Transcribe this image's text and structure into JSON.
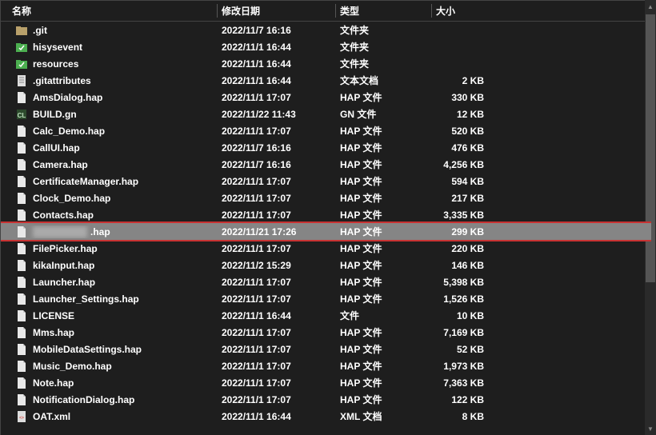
{
  "columns": {
    "name": "名称",
    "date": "修改日期",
    "type": "类型",
    "size": "大小"
  },
  "rows": [
    {
      "icon": "folder-plain",
      "name": ".git",
      "date": "2022/11/7 16:16",
      "type": "文件夹",
      "size": ""
    },
    {
      "icon": "folder-green",
      "name": "hisysevent",
      "date": "2022/11/1 16:44",
      "type": "文件夹",
      "size": ""
    },
    {
      "icon": "folder-green",
      "name": "resources",
      "date": "2022/11/1 16:44",
      "type": "文件夹",
      "size": ""
    },
    {
      "icon": "file-txt",
      "name": ".gitattributes",
      "date": "2022/11/1 16:44",
      "type": "文本文档",
      "size": "2 KB"
    },
    {
      "icon": "file-generic",
      "name": "AmsDialog.hap",
      "date": "2022/11/1 17:07",
      "type": "HAP 文件",
      "size": "330 KB"
    },
    {
      "icon": "file-cl",
      "name": "BUILD.gn",
      "date": "2022/11/22 11:43",
      "type": "GN 文件",
      "size": "12 KB"
    },
    {
      "icon": "file-generic",
      "name": "Calc_Demo.hap",
      "date": "2022/11/1 17:07",
      "type": "HAP 文件",
      "size": "520 KB"
    },
    {
      "icon": "file-generic",
      "name": "CallUI.hap",
      "date": "2022/11/7 16:16",
      "type": "HAP 文件",
      "size": "476 KB"
    },
    {
      "icon": "file-generic",
      "name": "Camera.hap",
      "date": "2022/11/7 16:16",
      "type": "HAP 文件",
      "size": "4,256 KB"
    },
    {
      "icon": "file-generic",
      "name": "CertificateManager.hap",
      "date": "2022/11/1 17:07",
      "type": "HAP 文件",
      "size": "594 KB"
    },
    {
      "icon": "file-generic",
      "name": "Clock_Demo.hap",
      "date": "2022/11/1 17:07",
      "type": "HAP 文件",
      "size": "217 KB"
    },
    {
      "icon": "file-generic",
      "name": "Contacts.hap",
      "date": "2022/11/1 17:07",
      "type": "HAP 文件",
      "size": "3,335 KB"
    },
    {
      "icon": "file-generic",
      "name": "",
      "name_obscured": true,
      "name_suffix": ".hap",
      "date": "2022/11/21 17:26",
      "type": "HAP 文件",
      "size": "299 KB",
      "selected": true
    },
    {
      "icon": "file-generic",
      "name": "FilePicker.hap",
      "date": "2022/11/1 17:07",
      "type": "HAP 文件",
      "size": "220 KB"
    },
    {
      "icon": "file-generic",
      "name": "kikaInput.hap",
      "date": "2022/11/2 15:29",
      "type": "HAP 文件",
      "size": "146 KB"
    },
    {
      "icon": "file-generic",
      "name": "Launcher.hap",
      "date": "2022/11/1 17:07",
      "type": "HAP 文件",
      "size": "5,398 KB"
    },
    {
      "icon": "file-generic",
      "name": "Launcher_Settings.hap",
      "date": "2022/11/1 17:07",
      "type": "HAP 文件",
      "size": "1,526 KB"
    },
    {
      "icon": "file-generic",
      "name": "LICENSE",
      "date": "2022/11/1 16:44",
      "type": "文件",
      "size": "10 KB"
    },
    {
      "icon": "file-generic",
      "name": "Mms.hap",
      "date": "2022/11/1 17:07",
      "type": "HAP 文件",
      "size": "7,169 KB"
    },
    {
      "icon": "file-generic",
      "name": "MobileDataSettings.hap",
      "date": "2022/11/1 17:07",
      "type": "HAP 文件",
      "size": "52 KB"
    },
    {
      "icon": "file-generic",
      "name": "Music_Demo.hap",
      "date": "2022/11/1 17:07",
      "type": "HAP 文件",
      "size": "1,973 KB"
    },
    {
      "icon": "file-generic",
      "name": "Note.hap",
      "date": "2022/11/1 17:07",
      "type": "HAP 文件",
      "size": "7,363 KB"
    },
    {
      "icon": "file-generic",
      "name": "NotificationDialog.hap",
      "date": "2022/11/1 17:07",
      "type": "HAP 文件",
      "size": "122 KB"
    },
    {
      "icon": "file-xml",
      "name": "OAT.xml",
      "date": "2022/11/1 16:44",
      "type": "XML 文档",
      "size": "8 KB"
    }
  ]
}
